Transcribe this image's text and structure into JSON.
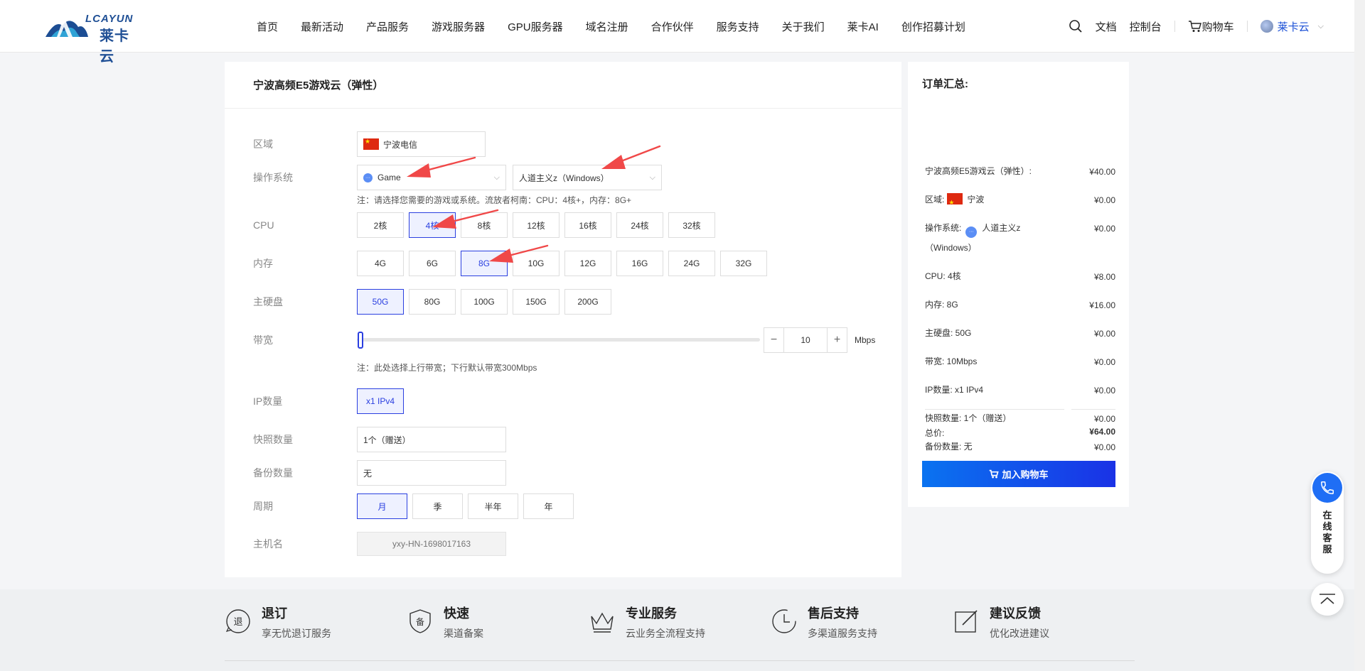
{
  "header": {
    "logo_text": "LCAYUN",
    "logo_cn": "莱卡云",
    "nav": [
      "首页",
      "最新活动",
      "产品服务",
      "游戏服务器",
      "GPU服务器",
      "域名注册",
      "合作伙伴",
      "服务支持",
      "关于我们",
      "莱卡AI",
      "创作招募计划"
    ],
    "docs": "文档",
    "console": "控制台",
    "cart": "购物车",
    "user": "莱卡云"
  },
  "product": {
    "title": "宁波高频E5游戏云（弹性）",
    "region_label": "区域",
    "region_value": "宁波电信",
    "os_label": "操作系统",
    "os_type": "Game",
    "os_image": "人道主义z（Windows）",
    "os_note": "注：请选择您需要的游戏或系统。流放者柯南：CPU：4核+，内存：8G+",
    "cpu_label": "CPU",
    "cpu_options": [
      "2核",
      "4核",
      "8核",
      "12核",
      "16核",
      "24核",
      "32核"
    ],
    "cpu_selected": "4核",
    "mem_label": "内存",
    "mem_options": [
      "4G",
      "6G",
      "8G",
      "10G",
      "12G",
      "16G",
      "24G",
      "32G"
    ],
    "mem_selected": "8G",
    "disk_label": "主硬盘",
    "disk_options": [
      "50G",
      "80G",
      "100G",
      "150G",
      "200G"
    ],
    "disk_selected": "50G",
    "bw_label": "带宽",
    "bw_value": "10",
    "bw_unit": "Mbps",
    "bw_note": "注：此处选择上行带宽；下行默认带宽300Mbps",
    "bw_minus": "−",
    "bw_plus": "+",
    "ip_label": "IP数量",
    "ip_value": "x1 IPv4",
    "snap_label": "快照数量",
    "snap_value": "1个（赠送）",
    "backup_label": "备份数量",
    "backup_value": "无",
    "period_label": "周期",
    "period_options": [
      "月",
      "季",
      "半年",
      "年"
    ],
    "period_selected": "月",
    "host_label": "主机名",
    "host_placeholder": "yxy-HN-1698017163"
  },
  "summary": {
    "title": "订单汇总:",
    "lines": [
      {
        "k": "宁波高频E5游戏云（弹性）:",
        "v": "¥40.00"
      },
      {
        "k": "区域:",
        "extra": "宁波",
        "v": "¥0.00"
      },
      {
        "k": "操作系统:",
        "extra": "人道主义z（Windows）",
        "v": "¥0.00"
      },
      {
        "k": "CPU: 4核",
        "v": "¥8.00"
      },
      {
        "k": "内存: 8G",
        "v": "¥16.00"
      },
      {
        "k": "主硬盘: 50G",
        "v": "¥0.00"
      },
      {
        "k": "带宽: 10Mbps",
        "v": "¥0.00"
      },
      {
        "k": "IP数量: x1 IPv4",
        "v": "¥0.00"
      },
      {
        "k": "快照数量: 1个（赠送）",
        "v": "¥0.00"
      },
      {
        "k": "备份数量: 无",
        "v": "¥0.00"
      }
    ],
    "total_label": "总价:",
    "total_value": "¥64.00",
    "cart_button": "加入购物车"
  },
  "footer": [
    {
      "title": "退订",
      "sub": "享无忧退订服务",
      "icon_char": "退"
    },
    {
      "title": "快速",
      "sub": "渠道备案",
      "icon_char": "备"
    },
    {
      "title": "专业服务",
      "sub": "云业务全流程支持"
    },
    {
      "title": "售后支持",
      "sub": "多渠道服务支持"
    },
    {
      "title": "建议反馈",
      "sub": "优化改进建议"
    }
  ],
  "float": {
    "service": "在线客服"
  },
  "colors": {
    "accent": "#2a3fe0",
    "arrow": "#f04848",
    "cart_start": "#0a73f0",
    "cart_end": "#1a32e6"
  }
}
